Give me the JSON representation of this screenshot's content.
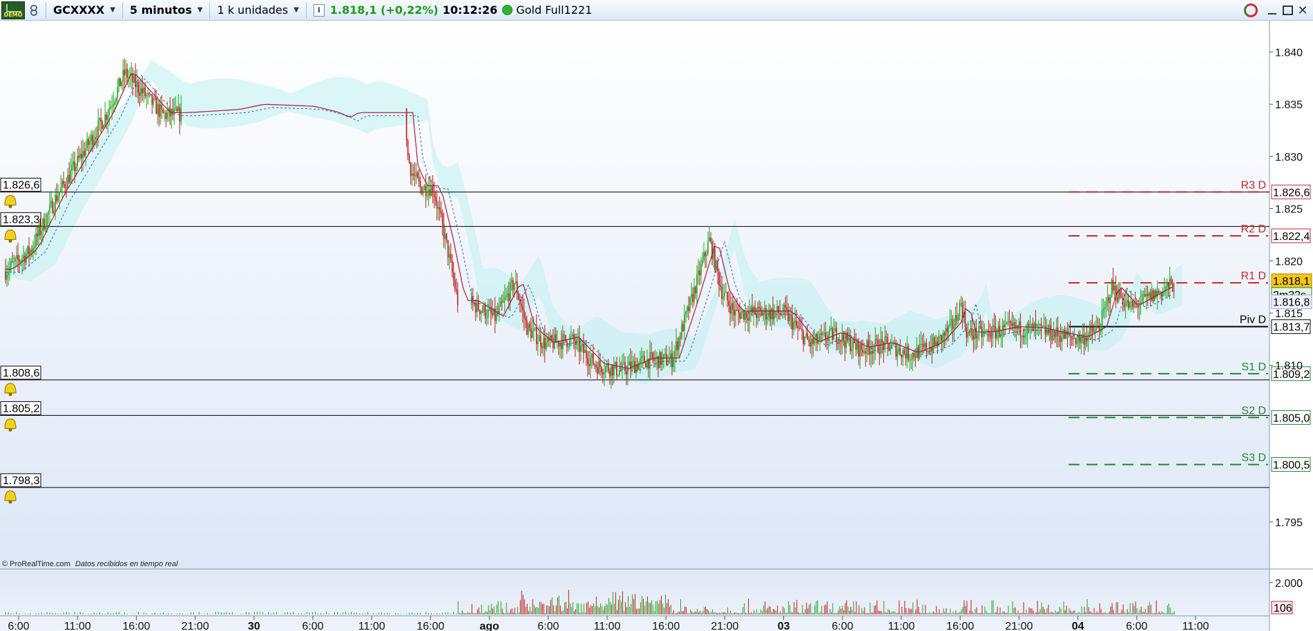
{
  "toolbar": {
    "demo_label": "DEMO",
    "symbol": "GCXXXX",
    "timeframe": "5 minutos",
    "units": "1 k unidades",
    "info_label": "i",
    "last_price": "1.818,1 (+0,22%)",
    "time": "10:12:26",
    "instrument": "Gold Full1221",
    "status_color": "#2fb52f"
  },
  "colors": {
    "candle_up": "#1ca81c",
    "candle_down": "#c01818",
    "resistance": "#c8242c",
    "support": "#1a8a2a",
    "pivot": "#000000",
    "cloud_up": "#bff0f0",
    "cloud_down": "#fbd2d8"
  },
  "chart_data": {
    "type": "candlestick",
    "price_axis": {
      "ylim": [
        1790.5,
        1843.0
      ],
      "ticks": [
        {
          "value": 1840,
          "label": "1.840"
        },
        {
          "value": 1835,
          "label": "1.835"
        },
        {
          "value": 1830,
          "label": "1.830"
        },
        {
          "value": 1825,
          "label": "1.825"
        },
        {
          "value": 1820,
          "label": "1.820"
        },
        {
          "value": 1815,
          "label": "1.815"
        },
        {
          "value": 1810,
          "label": "1.810"
        },
        {
          "value": 1795,
          "label": "1.795"
        }
      ]
    },
    "time_axis": [
      {
        "label": "6:00",
        "bold": false
      },
      {
        "label": "11:00",
        "bold": false
      },
      {
        "label": "16:00",
        "bold": false
      },
      {
        "label": "21:00",
        "bold": false
      },
      {
        "label": "30",
        "bold": true
      },
      {
        "label": "6:00",
        "bold": false
      },
      {
        "label": "11:00",
        "bold": false
      },
      {
        "label": "16:00",
        "bold": false
      },
      {
        "label": "ago",
        "bold": true
      },
      {
        "label": "6:00",
        "bold": false
      },
      {
        "label": "11:00",
        "bold": false
      },
      {
        "label": "16:00",
        "bold": false
      },
      {
        "label": "21:00",
        "bold": false
      },
      {
        "label": "03",
        "bold": true
      },
      {
        "label": "6:00",
        "bold": false
      },
      {
        "label": "11:00",
        "bold": false
      },
      {
        "label": "16:00",
        "bold": false
      },
      {
        "label": "21:00",
        "bold": false
      },
      {
        "label": "04",
        "bold": true
      },
      {
        "label": "6:00",
        "bold": false
      },
      {
        "label": "11:00",
        "bold": false
      }
    ],
    "horizontal_lines": [
      {
        "label": "1.826,6",
        "value": 1826.6
      },
      {
        "label": "1.823,3",
        "value": 1823.3
      },
      {
        "label": "1.808,6",
        "value": 1808.6
      },
      {
        "label": "1.805,2",
        "value": 1805.2
      },
      {
        "label": "1.798,3",
        "value": 1798.3
      }
    ],
    "pivot_levels": [
      {
        "name": "R3 D",
        "value": 1826.6,
        "label": "1.826,6",
        "kind": "resistance"
      },
      {
        "name": "R2 D",
        "value": 1822.4,
        "label": "1.822,4",
        "kind": "resistance"
      },
      {
        "name": "R1 D",
        "value": 1817.9,
        "label": "",
        "kind": "resistance"
      },
      {
        "name": "Piv D",
        "value": 1813.7,
        "label": "1.813,7",
        "kind": "pivot"
      },
      {
        "name": "S1 D",
        "value": 1809.2,
        "label": "1.809,2",
        "kind": "support"
      },
      {
        "name": "S2 D",
        "value": 1805.0,
        "label": "1.805,0",
        "kind": "support"
      },
      {
        "name": "S3 D",
        "value": 1800.5,
        "label": "1.800,5",
        "kind": "support"
      }
    ],
    "current_price": {
      "value": 1818.1,
      "label": "1.818,1"
    },
    "countdown": "2m32s",
    "secondary_price": {
      "value": 1816.8,
      "label": "1.816,8"
    },
    "price_path": [
      [
        0.0,
        1819
      ],
      [
        0.02,
        1821
      ],
      [
        0.04,
        1826
      ],
      [
        0.06,
        1830
      ],
      [
        0.08,
        1834
      ],
      [
        0.095,
        1838
      ],
      [
        0.11,
        1836
      ],
      [
        0.125,
        1834
      ],
      [
        0.14,
        1834
      ],
      [
        0.18,
        1834.3
      ],
      [
        0.2,
        1834.8
      ],
      [
        0.24,
        1834.6
      ],
      [
        0.26,
        1834
      ],
      [
        0.268,
        1833.5
      ],
      [
        0.275,
        1834
      ],
      [
        0.3,
        1834
      ],
      [
        0.318,
        1834
      ],
      [
        0.32,
        1830
      ],
      [
        0.323,
        1828.5
      ],
      [
        0.33,
        1827
      ],
      [
        0.34,
        1827
      ],
      [
        0.35,
        1822
      ],
      [
        0.36,
        1816
      ],
      [
        0.37,
        1816
      ],
      [
        0.39,
        1814.5
      ],
      [
        0.405,
        1818
      ],
      [
        0.415,
        1813.5
      ],
      [
        0.43,
        1812
      ],
      [
        0.45,
        1812.5
      ],
      [
        0.47,
        1810
      ],
      [
        0.49,
        1809.5
      ],
      [
        0.51,
        1810.5
      ],
      [
        0.53,
        1810.5
      ],
      [
        0.545,
        1816
      ],
      [
        0.56,
        1822
      ],
      [
        0.57,
        1817
      ],
      [
        0.58,
        1815
      ],
      [
        0.6,
        1815
      ],
      [
        0.62,
        1815
      ],
      [
        0.64,
        1812
      ],
      [
        0.66,
        1813
      ],
      [
        0.68,
        1811.5
      ],
      [
        0.7,
        1812
      ],
      [
        0.72,
        1811
      ],
      [
        0.74,
        1812
      ],
      [
        0.755,
        1814
      ],
      [
        0.76,
        1816
      ],
      [
        0.765,
        1813
      ],
      [
        0.78,
        1813
      ],
      [
        0.8,
        1813.5
      ],
      [
        0.82,
        1813.4
      ],
      [
        0.835,
        1813
      ],
      [
        0.855,
        1812.5
      ],
      [
        0.87,
        1813.5
      ],
      [
        0.88,
        1817.5
      ],
      [
        0.895,
        1815.5
      ],
      [
        0.91,
        1816.5
      ],
      [
        0.93,
        1817.8
      ]
    ],
    "session_gaps": [
      0.141,
      0.36,
      0.623,
      0.836
    ],
    "volume": {
      "ticks": [
        {
          "value": 2000,
          "label": "2.000"
        }
      ],
      "last": "106"
    }
  },
  "footer": {
    "credit": "© ProRealTime.com",
    "credit_note": "Datos recibidos en tiempo real"
  }
}
